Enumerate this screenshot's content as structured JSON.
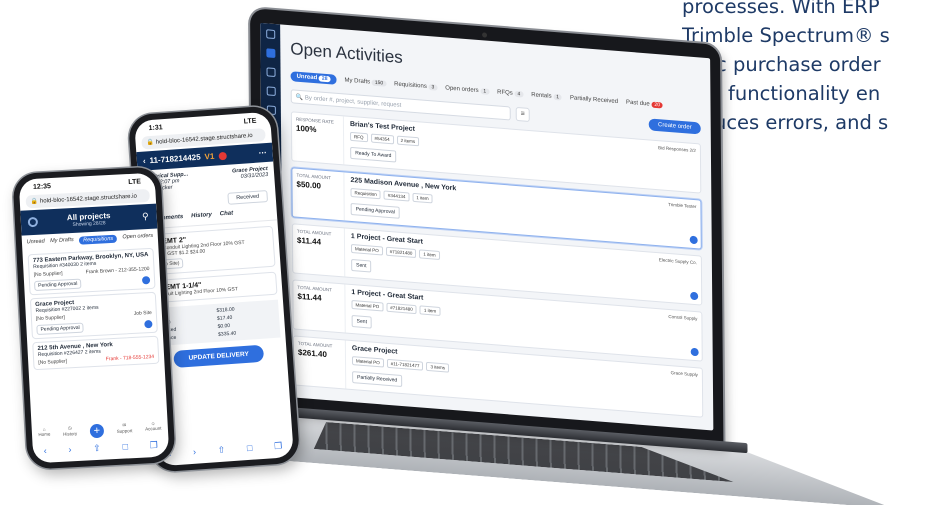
{
  "promo": {
    "lines": [
      "processes. With ERP",
      "Trimble Spectrum® s",
      "sync purchase order",
      "This functionality en",
      "reduces errors, and s"
    ]
  },
  "laptop": {
    "title": "Open Activities",
    "tabs": [
      {
        "label": "Unread",
        "count": "28"
      },
      {
        "label": "My Drafts",
        "count": "150"
      },
      {
        "label": "Requisitions",
        "count": "3"
      },
      {
        "label": "Open orders",
        "count": "1"
      },
      {
        "label": "RFQs",
        "count": "4"
      },
      {
        "label": "Rentals",
        "count": "1"
      },
      {
        "label": "Partially Received",
        "count": ""
      },
      {
        "label": "Past due",
        "count": "20"
      }
    ],
    "search_placeholder": "By order #, project, supplier, request",
    "create_label": "Create order",
    "rows": [
      {
        "amount_label": "RESPONSE RATE",
        "amount": "100%",
        "title": "Brian's Test Project",
        "chips": [
          "RFQ",
          "#54354",
          "2 items"
        ],
        "status": "Ready To Award",
        "right": "Bid Responses 2/2"
      },
      {
        "amount_label": "TOTAL AMOUNT",
        "amount": "$50.00",
        "title": "225 Madison Avenue , New York",
        "chips": [
          "Requisition",
          "#344134",
          "1 item"
        ],
        "status": "Pending Approval",
        "right": "Trimble Tester"
      },
      {
        "amount_label": "TOTAL AMOUNT",
        "amount": "$11.44",
        "title": "1 Project - Great Start",
        "chips": [
          "Material PO",
          "#71821480",
          "1 item"
        ],
        "status": "Sent",
        "right": "Electric Supply Co."
      },
      {
        "amount_label": "TOTAL AMOUNT",
        "amount": "$11.44",
        "title": "1 Project - Great Start",
        "chips": [
          "Material PO",
          "#71821480",
          "1 item"
        ],
        "status": "Sent",
        "right": "Consol Supply"
      },
      {
        "amount_label": "TOTAL AMOUNT",
        "amount": "$261.40",
        "title": "Grace Project",
        "chips": [
          "Material PO",
          "#11-71821477",
          "3 items"
        ],
        "status": "Partially Received",
        "right": "Grace Supply"
      }
    ]
  },
  "phone1": {
    "time": "12:35",
    "signal": "LTE",
    "url": "hold-bloc-16542.stage.structshare.io",
    "header_title": "All projects",
    "header_sub": "Showing 28/28",
    "tabs": [
      "Unread",
      "My Drafts",
      "Requisitions",
      "Open orders"
    ],
    "cards": [
      {
        "title": "773 Eastern Parkway, Brooklyn, NY, USA",
        "chip": "Requisition  #340030  2 items",
        "left": "[No Supplier]",
        "right": "Frank Brown - 212-355-1200",
        "status": "Pending Approval"
      },
      {
        "title": "Grace Project",
        "chip": "Requisition  #227002  2 items",
        "left": "[No Supplier]",
        "right": "Job Site",
        "status": "Pending Approval"
      },
      {
        "title": "212 5th Avenue , New York",
        "chip": "Requisition  #226427  2 items",
        "left": "[No Supplier]",
        "right": "Frank - 718-555-1234",
        "status": ""
      }
    ],
    "nav": [
      "Home",
      "History",
      "Support",
      "Account"
    ]
  },
  "phone2": {
    "time": "1:31",
    "signal": "LTE",
    "url": "hold-bloc-16542.stage.structshare.io",
    "po_number": "11-718214425",
    "version": "V1",
    "supplier": "Electrical Supp...",
    "project": "Grace Project",
    "date1": "03/07 2:07 pm",
    "date2": "03/31/2023",
    "person": "Bob Tucker",
    "status": "Received",
    "tabs": [
      "Attachments",
      "History",
      "Chat"
    ],
    "items": [
      {
        "title": "all EMT 2\"",
        "meta": "10 - Conduit  Lighting  2nd Floor  10% GST",
        "price": "$2.40 GST  $1.2  $24.00",
        "note": "(Job Site)"
      },
      {
        "title": "all EMT 1-1/4\"",
        "meta": "Conduit  Lighting  2nd Floor  10% GST",
        "price": "",
        "note": ""
      }
    ],
    "totals": [
      [
        "Total",
        "$318.00"
      ],
      [
        "(25%)",
        "$17.40"
      ],
      [
        "Invoiced",
        "$0.00"
      ],
      [
        "Balance",
        "$335.40"
      ],
      [
        "Amount",
        "$335.40"
      ]
    ],
    "update_label": "UPDATE DELIVERY"
  }
}
